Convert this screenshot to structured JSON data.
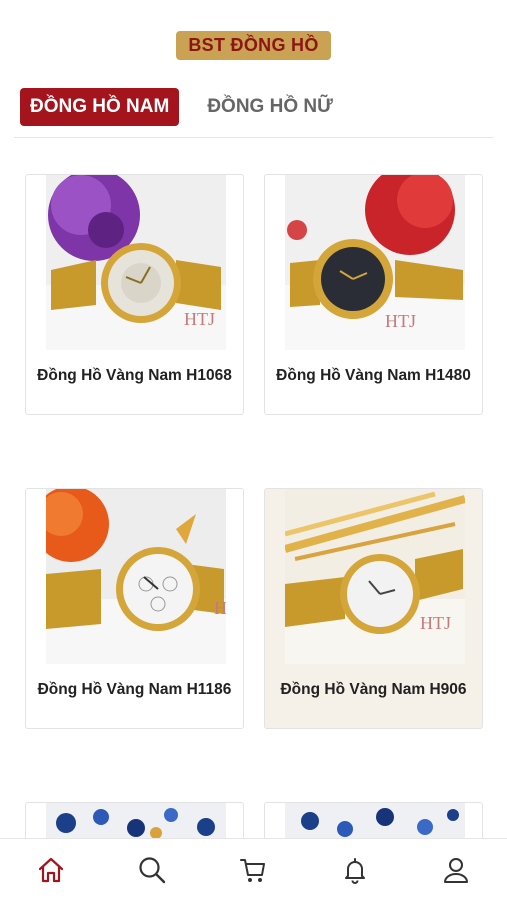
{
  "collection_badge": "BST ĐỒNG HỒ",
  "tabs": [
    {
      "label": "ĐỒNG HỒ NAM",
      "active": true
    },
    {
      "label": "ĐỒNG HỒ NỮ",
      "active": false
    }
  ],
  "products": [
    {
      "title": "Đồng Hồ Vàng Nam H1068",
      "watermark": "HTJ"
    },
    {
      "title": "Đồng Hồ Vàng Nam H1480",
      "watermark": "HTJ"
    },
    {
      "title": "Đồng Hồ Vàng Nam H1186",
      "watermark": "H"
    },
    {
      "title": "Đồng Hồ Vàng Nam H906",
      "watermark": "HTJ"
    }
  ],
  "bottom_nav": [
    {
      "icon": "home-icon",
      "active": true
    },
    {
      "icon": "search-icon",
      "active": false
    },
    {
      "icon": "cart-icon",
      "active": false
    },
    {
      "icon": "bell-icon",
      "active": false
    },
    {
      "icon": "user-icon",
      "active": false
    }
  ],
  "colors": {
    "brand_red": "#a3141c",
    "gold": "#c9a253",
    "badge_text": "#8e1515"
  }
}
